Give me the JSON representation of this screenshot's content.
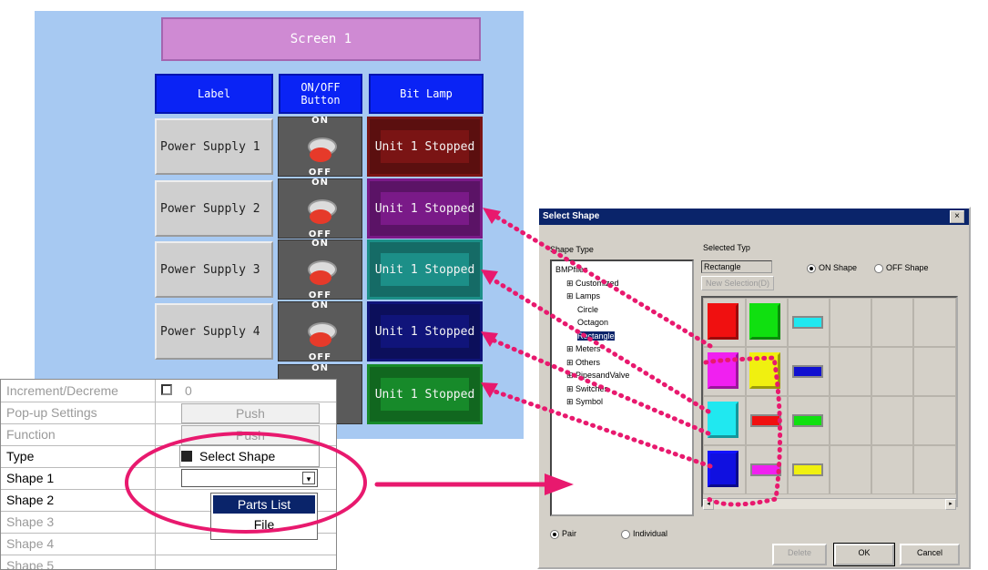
{
  "screen": {
    "title": "Screen 1",
    "headers": {
      "label": "Label",
      "onoff": "ON/OFF Button",
      "lamp": "Bit Lamp"
    },
    "switch_on": "ON",
    "switch_off": "OFF",
    "rows": [
      {
        "label": "Power Supply 1",
        "lamp": "Unit 1 Stopped",
        "lamp_color": "#7a1414"
      },
      {
        "label": "Power Supply 2",
        "lamp": "Unit 1 Stopped",
        "lamp_color": "#7a1a88"
      },
      {
        "label": "Power Supply 3",
        "lamp": "Unit 1 Stopped",
        "lamp_color": "#1c8f88"
      },
      {
        "label": "Power Supply 4",
        "lamp": "Unit 1 Stopped",
        "lamp_color": "#10147a"
      },
      {
        "label": "",
        "lamp": "Unit 1 Stopped",
        "lamp_color": "#178a2a"
      }
    ]
  },
  "properties": {
    "rows": [
      {
        "name": "Increment/Decreme",
        "value": "0",
        "style": "gray",
        "checkbox": true
      },
      {
        "name": "Pop-up Settings",
        "value": "Push",
        "style": "gray",
        "button": true
      },
      {
        "name": "Function",
        "value": "Push",
        "style": "gray",
        "button": true
      },
      {
        "name": "Type",
        "value": "Select Shape",
        "style": "blk"
      },
      {
        "name": "Shape 1",
        "value": "",
        "style": "blk",
        "dropdown": true
      },
      {
        "name": "Shape 2",
        "value": "",
        "style": "blk"
      },
      {
        "name": "Shape 3",
        "value": "",
        "style": "gray"
      },
      {
        "name": "Shape 4",
        "value": "",
        "style": "gray"
      },
      {
        "name": "Shape 5",
        "value": "",
        "style": "gray"
      }
    ],
    "dropdown_options": [
      "Parts List",
      "File"
    ]
  },
  "dialog": {
    "title": "Select Shape",
    "shape_type_label": "Shape Type",
    "selected_type_label": "Selected Typ",
    "selected_type_value": "Rectangle",
    "new_selection_button": "New Selection(D)",
    "on_shape": "ON Shape",
    "off_shape": "OFF Shape",
    "tree": [
      {
        "label": "BMPfiles",
        "level": 0
      },
      {
        "label": "Customized",
        "level": 1
      },
      {
        "label": "Lamps",
        "level": 1
      },
      {
        "label": "Circle",
        "level": 2
      },
      {
        "label": "Octagon",
        "level": 2
      },
      {
        "label": "Rectangle",
        "level": 2,
        "selected": true
      },
      {
        "label": "Meters",
        "level": 1
      },
      {
        "label": "Others",
        "level": 1
      },
      {
        "label": "PipesandValve",
        "level": 1
      },
      {
        "label": "Switches",
        "level": 1
      },
      {
        "label": "Symbol",
        "level": 1
      }
    ],
    "swatches": [
      {
        "color": "#f01010",
        "kind": "square",
        "row": 0,
        "col": 0
      },
      {
        "color": "#10e010",
        "kind": "square",
        "row": 0,
        "col": 1
      },
      {
        "color": "#20e8f0",
        "kind": "bar",
        "row": 0,
        "col": 2
      },
      {
        "color": "#f020f0",
        "kind": "square",
        "row": 1,
        "col": 0
      },
      {
        "color": "#f0f010",
        "kind": "square",
        "row": 1,
        "col": 1
      },
      {
        "color": "#1010d0",
        "kind": "bar",
        "row": 1,
        "col": 2
      },
      {
        "color": "#20e8f0",
        "kind": "square",
        "row": 2,
        "col": 0
      },
      {
        "color": "#f01010",
        "kind": "bar",
        "row": 2,
        "col": 1
      },
      {
        "color": "#10e010",
        "kind": "bar",
        "row": 2,
        "col": 2
      },
      {
        "color": "#1010e0",
        "kind": "square",
        "row": 3,
        "col": 0
      },
      {
        "color": "#f020f0",
        "kind": "bar",
        "row": 3,
        "col": 1
      },
      {
        "color": "#f0f010",
        "kind": "bar",
        "row": 3,
        "col": 2
      }
    ],
    "pair_label": "Pair",
    "individual_label": "Individual",
    "delete_button": "Delete",
    "ok_button": "OK",
    "cancel_button": "Cancel"
  },
  "colors": {
    "highlight_pink": "#e8196e",
    "header_blue": "#0a23f5",
    "screen_bg": "#a7c9f2"
  }
}
